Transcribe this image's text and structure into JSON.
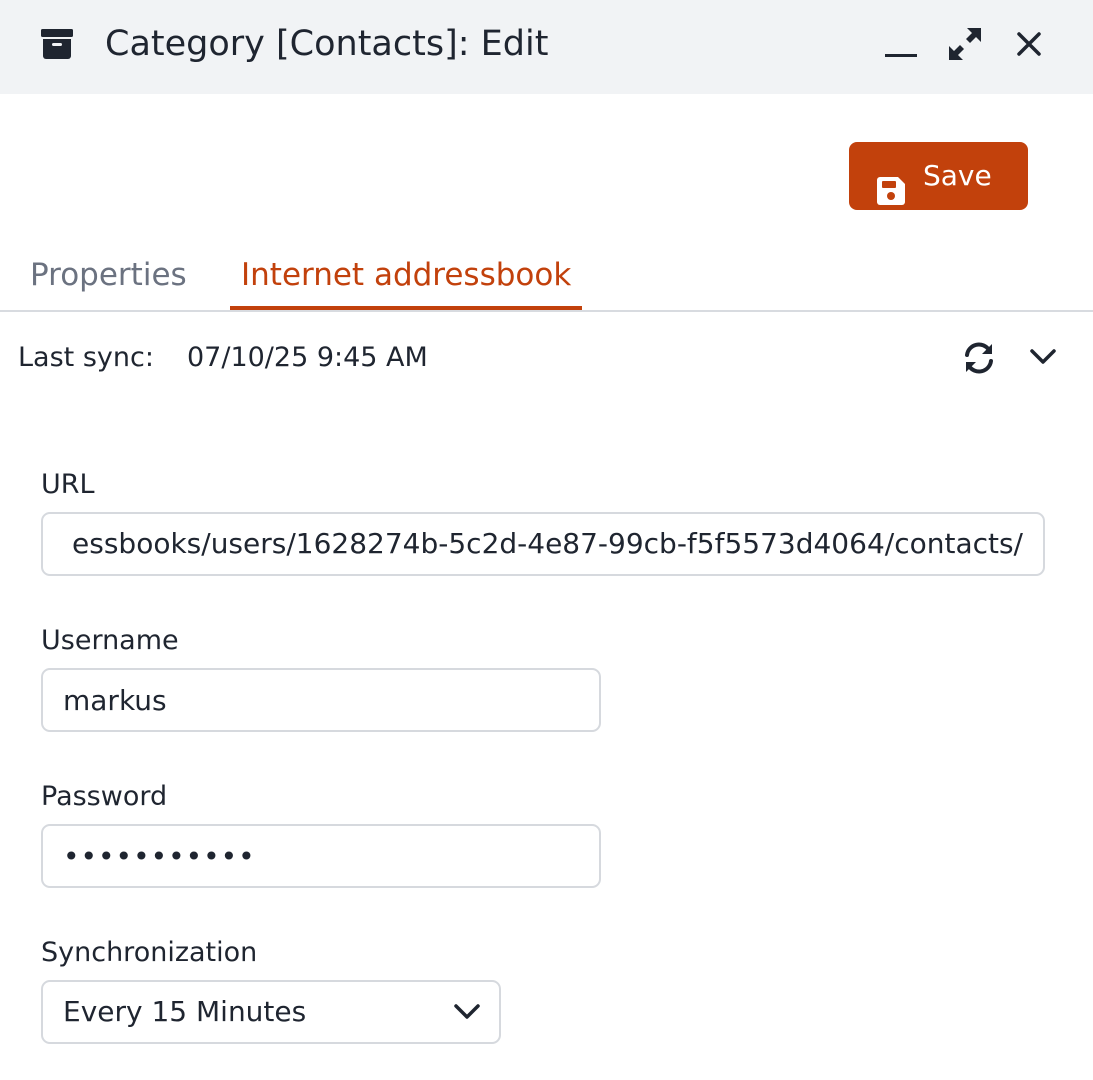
{
  "window": {
    "title": "Category [Contacts]: Edit",
    "icon": "archive-icon",
    "controls": [
      "minimize-icon",
      "maximize-icon",
      "close-icon"
    ]
  },
  "toolbar": {
    "save_label": "Save",
    "save_icon": "floppy-disk-icon",
    "accent_color": "#c2410c"
  },
  "tabs": [
    {
      "label": "Properties",
      "active": false
    },
    {
      "label": "Internet addressbook",
      "active": true
    }
  ],
  "sync": {
    "label": "Last sync:",
    "value": "07/10/25 9:45 AM",
    "refresh_icon": "refresh-icon",
    "expand_icon": "chevron-down-icon"
  },
  "form": {
    "url": {
      "label": "URL",
      "visible_value": "essbooks/users/1628274b-5c2d-4e87-99cb-f5f5573d4064/contacts/"
    },
    "username": {
      "label": "Username",
      "value": "markus"
    },
    "password": {
      "label": "Password",
      "value": "•••••••••••"
    },
    "synchronization": {
      "label": "Synchronization",
      "selected": "Every 15 Minutes"
    }
  }
}
